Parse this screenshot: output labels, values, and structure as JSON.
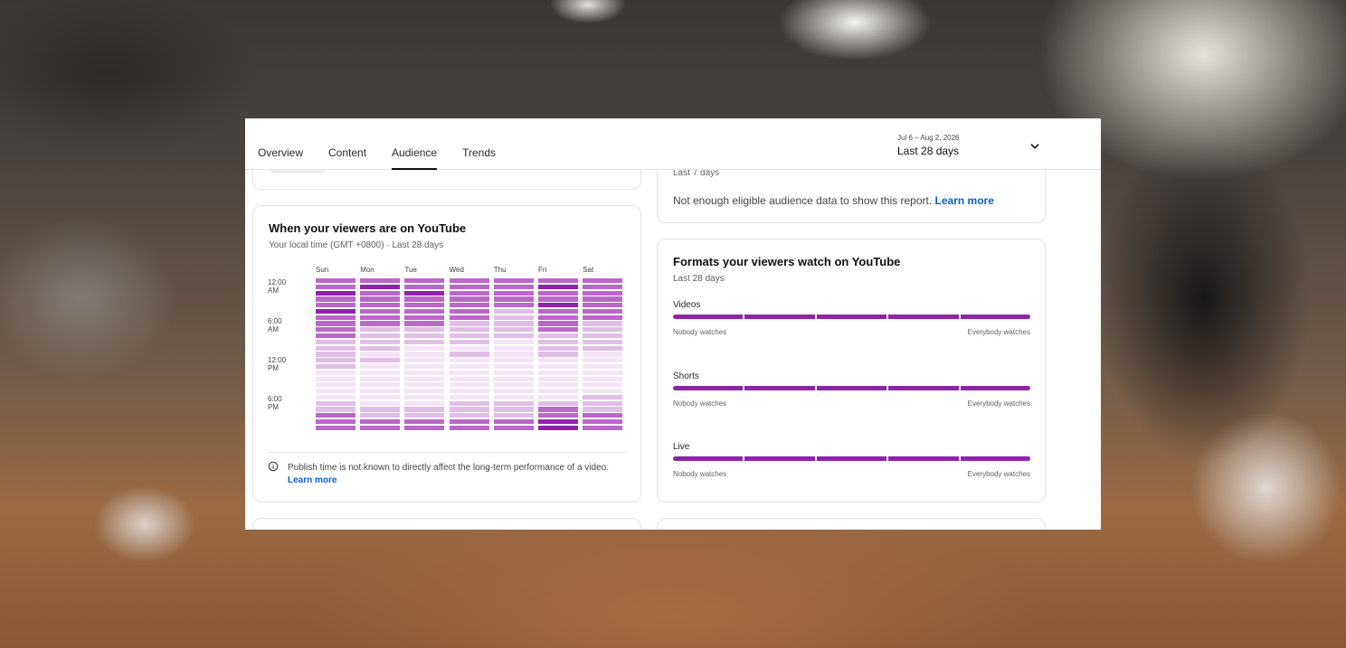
{
  "tabs": [
    {
      "label": "Overview",
      "active": false
    },
    {
      "label": "Content",
      "active": false
    },
    {
      "label": "Audience",
      "active": true
    },
    {
      "label": "Trends",
      "active": false
    }
  ],
  "date_picker": {
    "range": "Jul 6 – Aug 2, 2026",
    "label": "Last 28 days",
    "icon": "chevron-down-icon"
  },
  "top_right_card": {
    "subtitle": "Last 7 days",
    "message": "Not enough eligible audience data to show this report.",
    "link": "Learn more"
  },
  "when_card": {
    "title": "When your viewers are on YouTube",
    "subtitle": "Your local time (GMT +0800) · Last 28 days",
    "days": [
      "Sun",
      "Mon",
      "Tue",
      "Wed",
      "Thu",
      "Fri",
      "Sat"
    ],
    "times": [
      "12:00 AM",
      "6:00 AM",
      "12:00 PM",
      "6:00 PM"
    ],
    "heatmap_levels_0_to_4": [
      [
        3,
        3,
        4,
        3,
        3,
        4,
        3,
        3,
        3,
        3,
        2,
        2,
        2,
        2,
        2,
        1,
        1,
        1,
        1,
        1,
        2,
        2,
        3,
        3,
        3
      ],
      [
        3,
        4,
        3,
        3,
        3,
        3,
        3,
        3,
        2,
        2,
        2,
        2,
        1,
        2,
        1,
        1,
        1,
        1,
        1,
        1,
        1,
        2,
        2,
        3,
        3
      ],
      [
        3,
        3,
        4,
        3,
        3,
        3,
        3,
        3,
        2,
        2,
        2,
        1,
        1,
        1,
        1,
        1,
        1,
        1,
        1,
        1,
        1,
        2,
        2,
        3,
        3
      ],
      [
        3,
        3,
        3,
        3,
        3,
        3,
        3,
        2,
        2,
        2,
        2,
        1,
        2,
        1,
        1,
        1,
        1,
        1,
        1,
        1,
        2,
        2,
        2,
        3,
        3
      ],
      [
        3,
        3,
        3,
        3,
        3,
        2,
        2,
        2,
        2,
        2,
        1,
        1,
        1,
        1,
        1,
        1,
        1,
        1,
        1,
        1,
        2,
        2,
        2,
        3,
        3
      ],
      [
        3,
        4,
        3,
        3,
        4,
        3,
        3,
        3,
        3,
        2,
        2,
        2,
        2,
        1,
        1,
        1,
        1,
        1,
        1,
        1,
        2,
        3,
        3,
        4,
        4
      ],
      [
        3,
        3,
        3,
        3,
        3,
        3,
        3,
        2,
        2,
        2,
        2,
        2,
        1,
        1,
        1,
        1,
        1,
        1,
        1,
        2,
        2,
        2,
        3,
        3,
        3
      ]
    ],
    "note": "Publish time is not known to directly affect the long-term performance of a video.",
    "note_link": "Learn more",
    "note_icon": "info-icon",
    "colors": {
      "level1": "#f3e5f5",
      "level2": "#e1bee7",
      "level3": "#ba68c8",
      "level4": "#8e24aa"
    }
  },
  "formats_card": {
    "title": "Formats your viewers watch on YouTube",
    "subtitle": "Last 28 days",
    "formats": [
      {
        "name": "Videos",
        "min_label": "Nobody watches",
        "max_label": "Everybody watches"
      },
      {
        "name": "Shorts",
        "min_label": "Nobody watches",
        "max_label": "Everybody watches"
      },
      {
        "name": "Live",
        "min_label": "Nobody watches",
        "max_label": "Everybody watches"
      }
    ],
    "bar_color": "#8e24aa"
  }
}
